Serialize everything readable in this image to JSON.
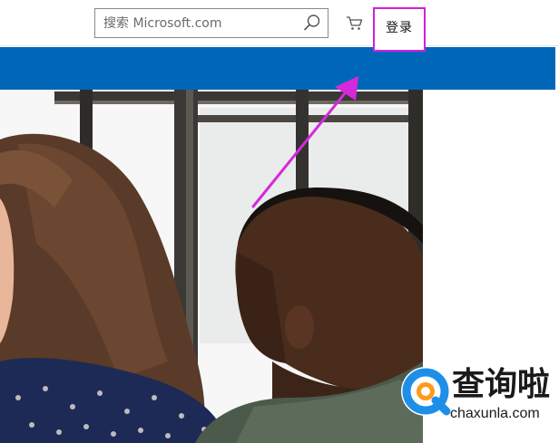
{
  "header": {
    "search": {
      "placeholder": "搜索 Microsoft.com",
      "value": ""
    },
    "icons": {
      "search": "search-icon",
      "cart": "cart-icon"
    },
    "signin_label": "登录"
  },
  "colors": {
    "brand_band": "#0067b8",
    "highlight": "#d21fe0",
    "watermark_blue": "#1e8fe8",
    "watermark_orange": "#ff9a1c"
  },
  "watermark": {
    "title": "查询啦",
    "url": "chaxunla.com"
  }
}
